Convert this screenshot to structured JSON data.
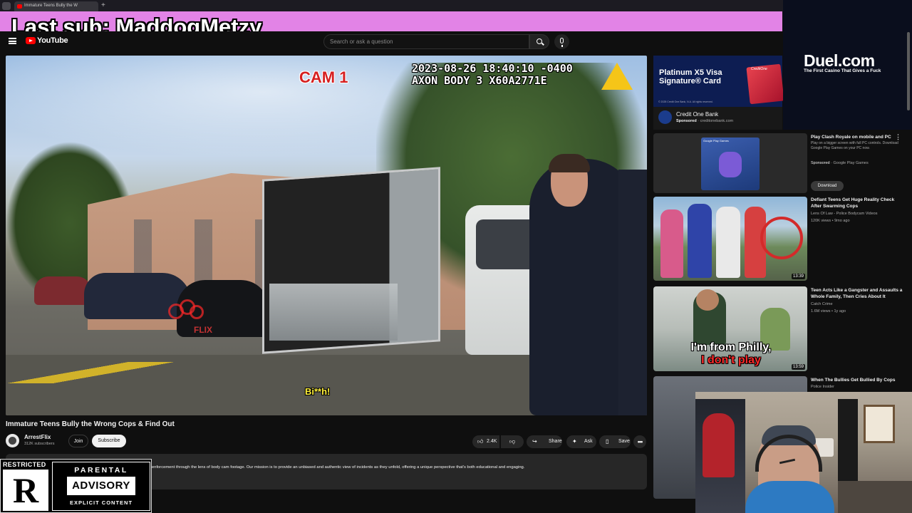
{
  "browser": {
    "tab_title": "Immature Teens Bully the W",
    "new_tab_icon": "plus-icon"
  },
  "overlay": {
    "last_sub": "Last sub: MaddogMetzy"
  },
  "header": {
    "logo_text": "YouTube",
    "search_placeholder": "Search or ask a question"
  },
  "player": {
    "cam_label": "CAM 1",
    "timestamp": "2023-08-26 18:40:10 -0400",
    "device": "AXON BODY 3 X60A2771E",
    "caption": "Bi**h!",
    "watermark": "FLIX"
  },
  "video": {
    "title": "Immature Teens Bully the Wrong Cops & Find Out",
    "channel": "ArrestFlix",
    "subscribers": "312K subscribers",
    "join_label": "Join",
    "subscribe_label": "Subscribe",
    "likes": "2.4K",
    "share_label": "Share",
    "ask_label": "Ask",
    "save_label": "Save",
    "more_label": "•••",
    "description": "enforcement through the lens of body cam footage. Our mission is to provide an unbiased and authentic view of incidents as they unfold, offering a unique perspective that's both educational and engaging."
  },
  "restricted_overlay": {
    "label": "RESTRICTED",
    "letter": "R",
    "pa_top": "PARENTAL",
    "pa_mid": "ADVISORY",
    "pa_bottom": "EXPLICIT CONTENT"
  },
  "sidebar": {
    "ad": {
      "headline": "Platinum X5 Visa Signature® Card",
      "card_logo": "CreditOne",
      "fine_print": "© 2025 Credit One Bank, N.A. All rights reserved.",
      "advertiser": "Credit One Bank",
      "sponsored": "Sponsored",
      "domain": "creditonebank.com"
    },
    "duel": {
      "logo": "Duel.com",
      "tagline": "The First Casino That Gives a Fuck"
    },
    "game_ad": {
      "title": "Play Clash Royale on mobile and PC",
      "desc": "Play on a bigger screen with full PC controls. Download Google Play Games on your PC now.",
      "sponsored": "Sponsored",
      "source": "Google Play Games",
      "button": "Download",
      "thumb_label": "Google Play Games"
    },
    "recommendations": [
      {
        "title": "Defiant Teens Get Huge Reality Check After Swarming Cops",
        "channel": "Lens Of Law - Police Bodycam Videos",
        "stats": "120K views • 9mo ago",
        "duration": "13:39"
      },
      {
        "title": "Teen Acts Like a Gangster and Assaults a Whole Family, Then Cries About It",
        "channel": "Catch Crime",
        "stats": "1.6M views • 1y ago",
        "duration": "13:59",
        "thumb_caption_1": "I'm from Philly,",
        "thumb_caption_2": "I don't play"
      },
      {
        "title": "When The Bullies Get Bullied By Cops",
        "channel": "Police Insider"
      }
    ]
  }
}
